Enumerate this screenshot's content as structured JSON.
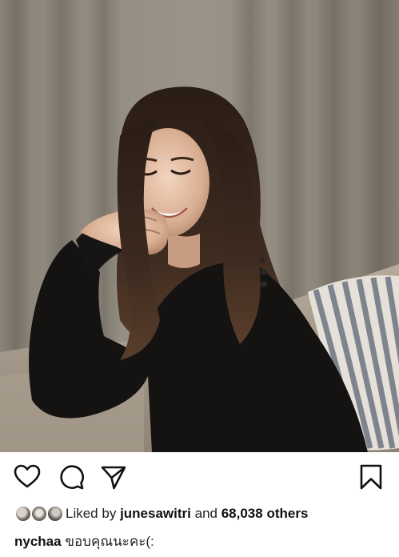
{
  "post": {
    "photo": {
      "description_icon": "post-photo"
    },
    "actions": {
      "like_icon": "heart-outline-icon",
      "comment_icon": "comment-bubble-icon",
      "share_icon": "paper-plane-icon",
      "save_icon": "bookmark-icon"
    },
    "likes": {
      "prefix": "Liked by",
      "user": "junesawitri",
      "connector": "and",
      "count": "68,038 others"
    },
    "caption": {
      "username": "nychaa",
      "text": "ขอบคุณนะคะ(:"
    }
  },
  "colors": {
    "icon": "#111111",
    "text": "#222222",
    "background": "#ffffff"
  }
}
